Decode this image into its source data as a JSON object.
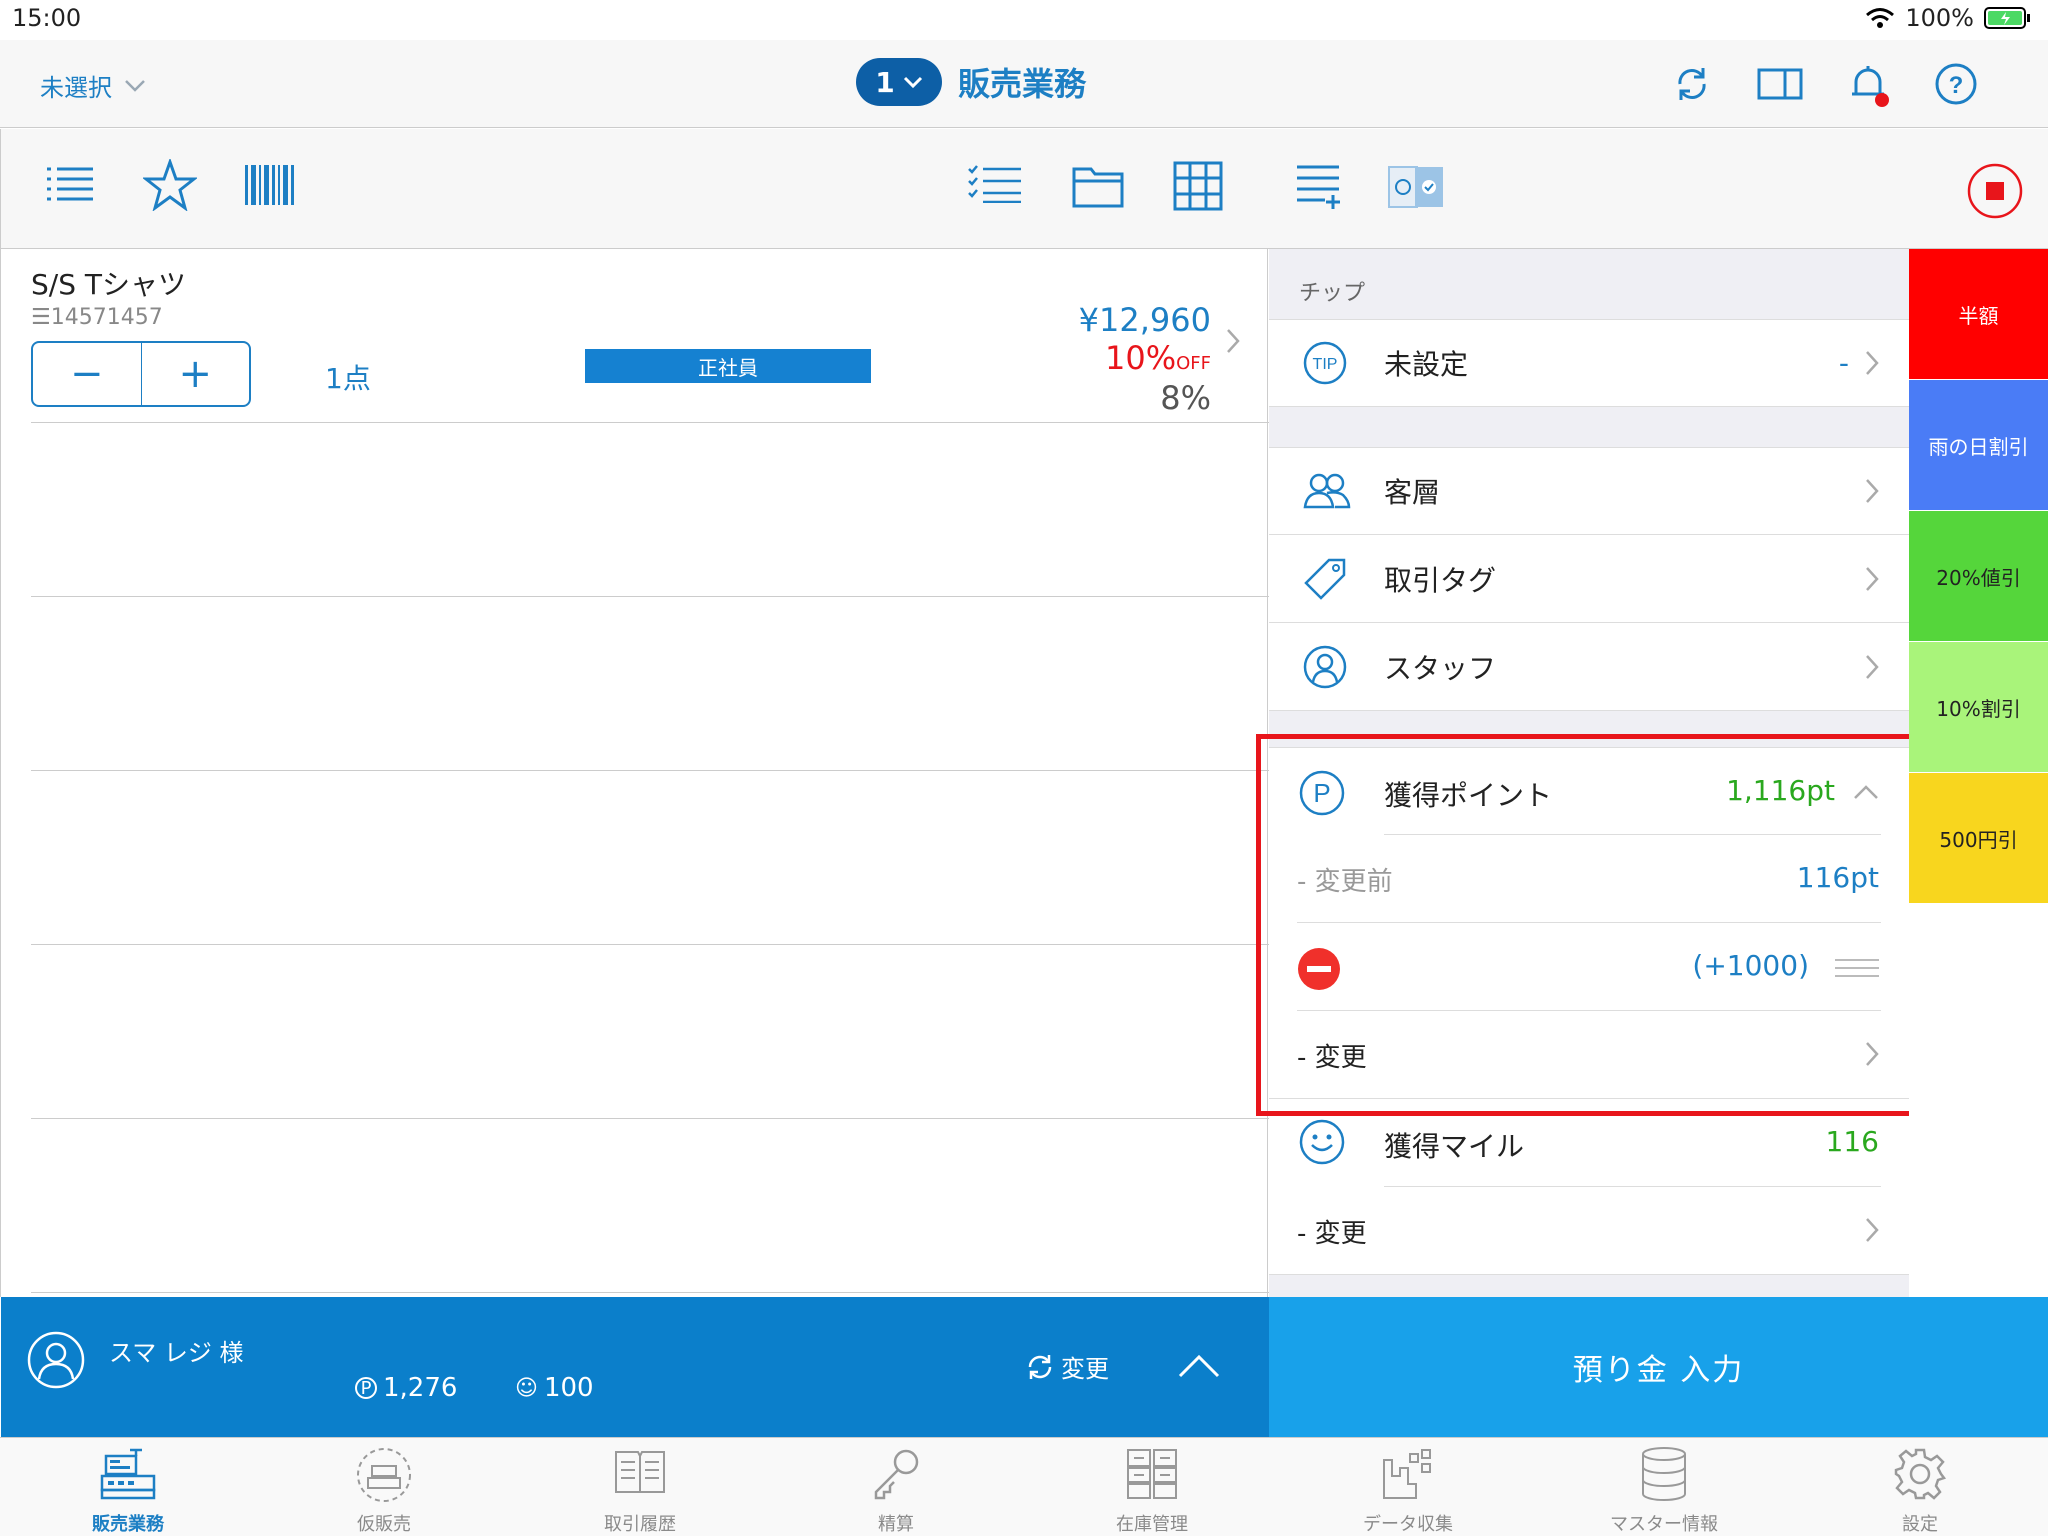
{
  "status_bar": {
    "time": "15:00",
    "battery": "100%"
  },
  "nav": {
    "staff_selector": "未選択",
    "register_number": "1",
    "title": "販売業務"
  },
  "cart": {
    "item": {
      "name": "S/S Tシャツ",
      "code": "14571457",
      "quantity": "1点",
      "tag": "正社員",
      "price": "¥12,960",
      "discount": "10%",
      "discount_suffix": "OFF",
      "tax": "8%"
    }
  },
  "customer": {
    "name": "スマ レジ 様",
    "points": "1,276",
    "miles": "100",
    "change_label": "変更"
  },
  "sidebar": {
    "tip_header": "チップ",
    "tip_label": "未設定",
    "tip_value": "-",
    "customer_type": "客層",
    "transaction_tag": "取引タグ",
    "staff": "スタッフ",
    "points_label": "獲得ポイント",
    "points_value": "1,116pt",
    "points_before_label": "- 変更前",
    "points_before_value": "116pt",
    "points_delta": "(+1000)",
    "points_change_label": "- 変更",
    "miles_label": "獲得マイル",
    "miles_value": "116",
    "miles_change_label": "- 変更"
  },
  "quick_buttons": [
    {
      "label": "半額",
      "color": "#ff0000"
    },
    {
      "label": "雨の日割引",
      "color": "#4a7cf6"
    },
    {
      "label": "20%値引",
      "color": "#55d63b"
    },
    {
      "label": "10%割引",
      "color": "#a9f47a"
    },
    {
      "label": "500円引",
      "color": "#f8d61e"
    }
  ],
  "deposit_button": "預り金 入力",
  "tabs": [
    {
      "label": "販売業務",
      "icon": "register-icon"
    },
    {
      "label": "仮販売",
      "icon": "temp-sale-icon"
    },
    {
      "label": "取引履歴",
      "icon": "history-icon"
    },
    {
      "label": "精算",
      "icon": "key-icon"
    },
    {
      "label": "在庫管理",
      "icon": "inventory-icon"
    },
    {
      "label": "データ収集",
      "icon": "data-icon"
    },
    {
      "label": "マスター情報",
      "icon": "database-icon"
    },
    {
      "label": "設定",
      "icon": "gear-icon"
    }
  ],
  "colors": {
    "accent": "#1d7fc4",
    "customer_bar": "#0b7fcb",
    "deposit": "#18a1ea",
    "points_green": "#2aa81e",
    "highlight": "#e8151b"
  }
}
